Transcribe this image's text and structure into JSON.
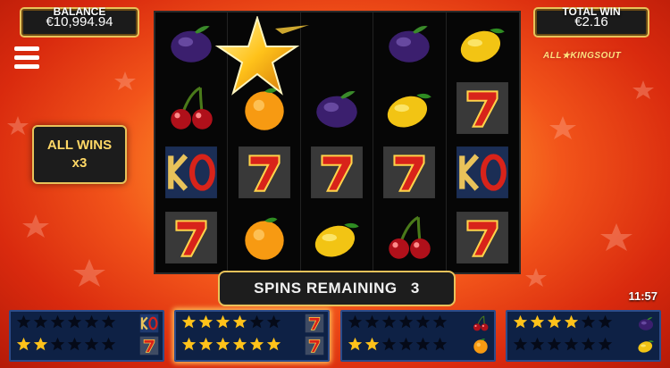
{
  "balance": {
    "label": "BALANCE",
    "value": "€10,994.94"
  },
  "total_win": {
    "label": "TOTAL WIN",
    "value": "€2.16"
  },
  "logo": {
    "text": "ALL★KINGSOUT"
  },
  "all_wins": {
    "line1": "ALL WINS",
    "line2": "x3"
  },
  "spins": {
    "label": "SPINS REMAINING",
    "count": "3"
  },
  "clock": "11:57",
  "colors": {
    "accent_gold": "#e8c25a",
    "reel_bg": "#060606",
    "panel_bg": "#0e2145",
    "star_gold": "#ffc21a"
  },
  "reel_grid": [
    [
      "plum-icon",
      "star-wild-icon",
      "empty",
      "plum-icon",
      "lemon-icon"
    ],
    [
      "cherries-icon",
      "orange-icon",
      "plum-icon",
      "lemon-icon",
      "seven-icon"
    ],
    [
      "ko-icon",
      "seven-icon",
      "seven-icon",
      "seven-icon",
      "ko-icon"
    ],
    [
      "seven-icon",
      "orange-icon",
      "lemon-icon",
      "cherries-icon",
      "seven-icon"
    ]
  ],
  "collect_panels": [
    {
      "row1_stars": 0,
      "row1_symbol": "ko-icon",
      "row2_stars": 2,
      "row2_symbol": "seven-icon",
      "highlight": false
    },
    {
      "row1_stars": 4,
      "row1_symbol": "seven-icon",
      "row2_stars": 6,
      "row2_symbol": "seven-icon",
      "highlight": true
    },
    {
      "row1_stars": 0,
      "row1_symbol": "cherries-icon",
      "row2_stars": 2,
      "row2_symbol": "orange-icon",
      "highlight": false
    },
    {
      "row1_stars": 4,
      "row1_symbol": "plum-icon",
      "row2_stars": 0,
      "row2_symbol": "lemon-icon",
      "highlight": false
    }
  ]
}
